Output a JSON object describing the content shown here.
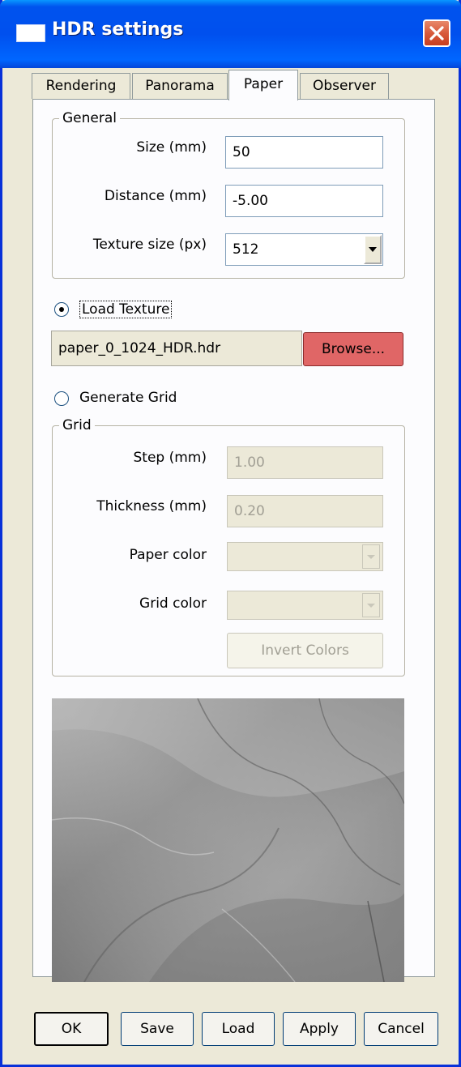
{
  "window": {
    "title": "HDR settings"
  },
  "tabs": [
    {
      "label": "Rendering",
      "active": false
    },
    {
      "label": "Panorama",
      "active": false
    },
    {
      "label": "Paper",
      "active": true
    },
    {
      "label": "Observer",
      "active": false
    }
  ],
  "general": {
    "legend": "General",
    "size_label": "Size (mm)",
    "size_value": "50",
    "distance_label": "Distance (mm)",
    "distance_value": "-5.00",
    "texture_size_label": "Texture size (px)",
    "texture_size_value": "512"
  },
  "load_texture": {
    "label": "Load Texture",
    "selected": true,
    "file_value": "paper_0_1024_HDR.hdr",
    "browse_label": "Browse..."
  },
  "generate_grid": {
    "label": "Generate Grid",
    "selected": false
  },
  "grid": {
    "legend": "Grid",
    "step_label": "Step (mm)",
    "step_value": "1.00",
    "thickness_label": "Thickness (mm)",
    "thickness_value": "0.20",
    "paper_color_label": "Paper color",
    "grid_color_label": "Grid color",
    "invert_label": "Invert Colors"
  },
  "buttons": {
    "ok": "OK",
    "save": "Save",
    "load": "Load",
    "apply": "Apply",
    "cancel": "Cancel"
  },
  "colors": {
    "titlebar": "#0054e3",
    "dialog_bg": "#ece9d8",
    "browse_button": "#e06666"
  }
}
